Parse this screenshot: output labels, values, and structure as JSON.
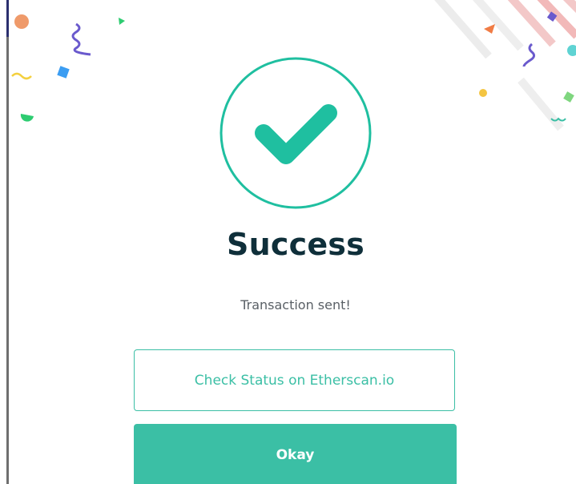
{
  "dialog": {
    "title": "Success",
    "message": "Transaction sent!",
    "check_status_label": "Check Status on Etherscan.io",
    "okay_label": "Okay"
  },
  "icons": {
    "status": "checkmark-icon"
  },
  "colors": {
    "accent": "#3bbfa5",
    "title": "#0f2f3a",
    "message": "#5a6066",
    "watermark": "#e34b4b"
  }
}
